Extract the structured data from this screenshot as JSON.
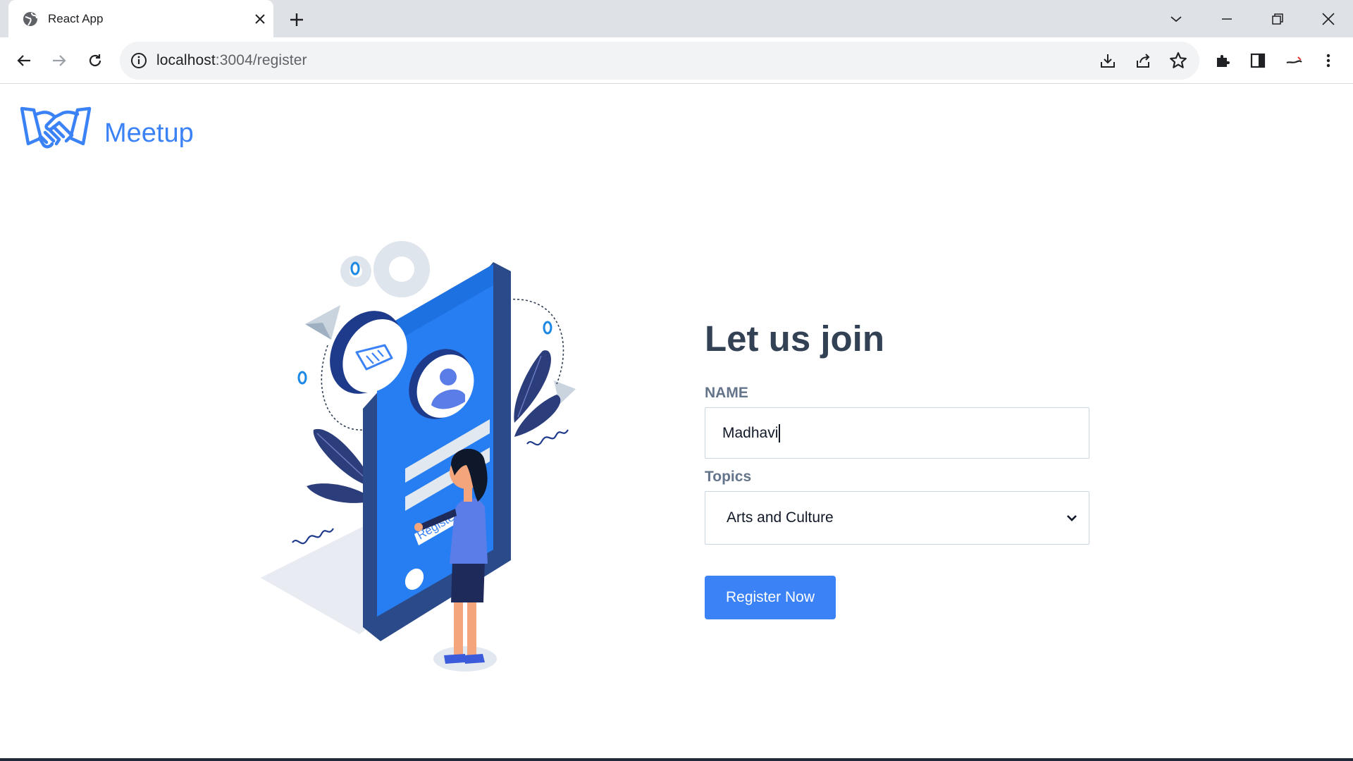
{
  "browser": {
    "tab_title": "React App",
    "url_host": "localhost",
    "url_rest": ":3004/register"
  },
  "brand": {
    "name": "Meetup"
  },
  "illustration": {
    "button_text": "Register"
  },
  "form": {
    "heading": "Let us join",
    "name_label": "NAME",
    "name_value": "Madhavi",
    "topics_label": "Topics",
    "topics_value": "Arts and Culture",
    "submit_label": "Register Now"
  },
  "colors": {
    "accent": "#3b82f6",
    "heading": "#334155",
    "label": "#64748b"
  }
}
